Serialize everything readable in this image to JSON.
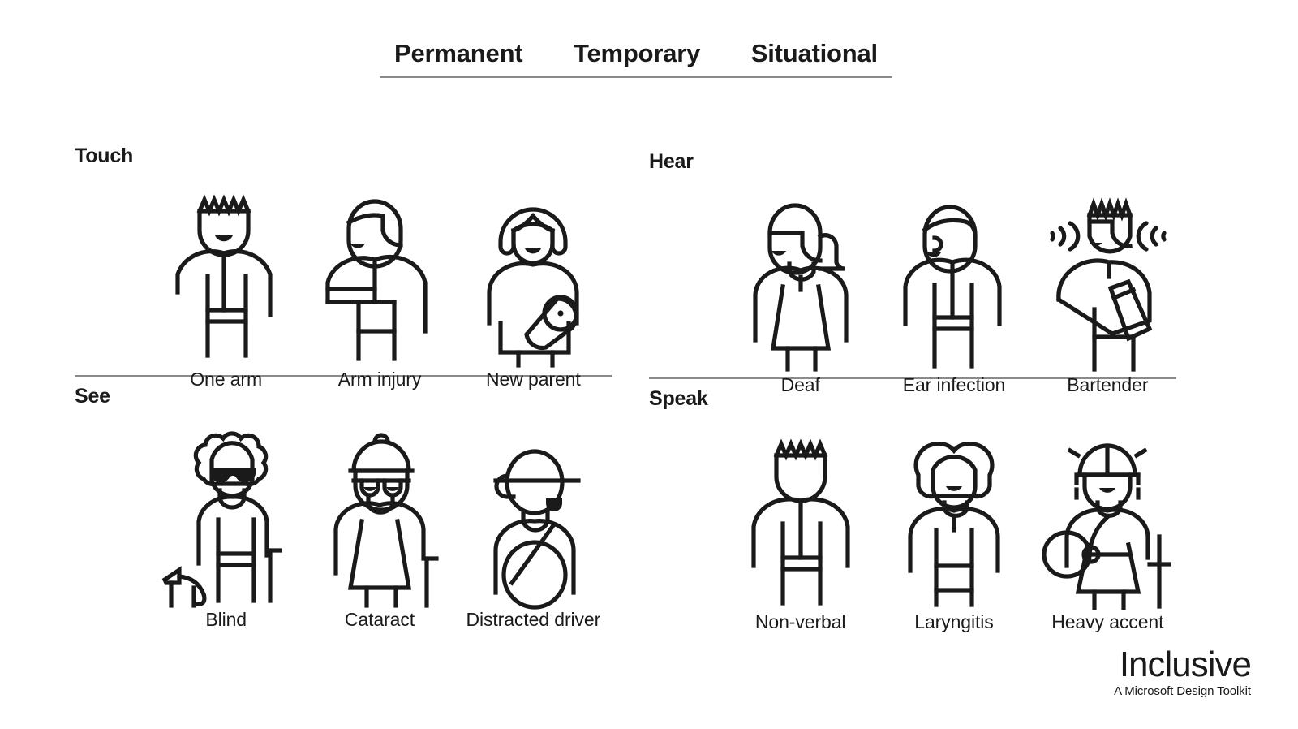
{
  "header": {
    "columns": [
      "Permanent",
      "Temporary",
      "Situational"
    ]
  },
  "sections": [
    {
      "id": "touch",
      "title": "Touch",
      "position": "top-left",
      "figures": [
        {
          "label": "One arm",
          "icon": "person-one-arm-icon",
          "column": "Permanent"
        },
        {
          "label": "Arm injury",
          "icon": "person-arm-sling-icon",
          "column": "Temporary"
        },
        {
          "label": "New parent",
          "icon": "person-holding-baby-icon",
          "column": "Situational"
        }
      ]
    },
    {
      "id": "hear",
      "title": "Hear",
      "position": "top-right",
      "figures": [
        {
          "label": "Deaf",
          "icon": "person-deaf-icon",
          "column": "Permanent"
        },
        {
          "label": "Ear infection",
          "icon": "person-ear-infection-icon",
          "column": "Temporary"
        },
        {
          "label": "Bartender",
          "icon": "person-bartender-icon",
          "column": "Situational"
        }
      ]
    },
    {
      "id": "see",
      "title": "See",
      "position": "bottom-left",
      "figures": [
        {
          "label": "Blind",
          "icon": "person-blind-guide-dog-icon",
          "column": "Permanent"
        },
        {
          "label": "Cataract",
          "icon": "person-cataract-icon",
          "column": "Temporary"
        },
        {
          "label": "Distracted driver",
          "icon": "person-driver-icon",
          "column": "Situational"
        }
      ]
    },
    {
      "id": "speak",
      "title": "Speak",
      "position": "bottom-right",
      "figures": [
        {
          "label": "Non-verbal",
          "icon": "person-non-verbal-icon",
          "column": "Permanent"
        },
        {
          "label": "Laryngitis",
          "icon": "person-laryngitis-icon",
          "column": "Temporary"
        },
        {
          "label": "Heavy accent",
          "icon": "person-traveler-icon",
          "column": "Situational"
        }
      ]
    }
  ],
  "logo": {
    "title": "Inclusive",
    "subtitle": "A Microsoft Design Toolkit"
  },
  "colors": {
    "ink": "#1a1a1a",
    "rule": "#8a8a8a",
    "background": "#ffffff"
  }
}
